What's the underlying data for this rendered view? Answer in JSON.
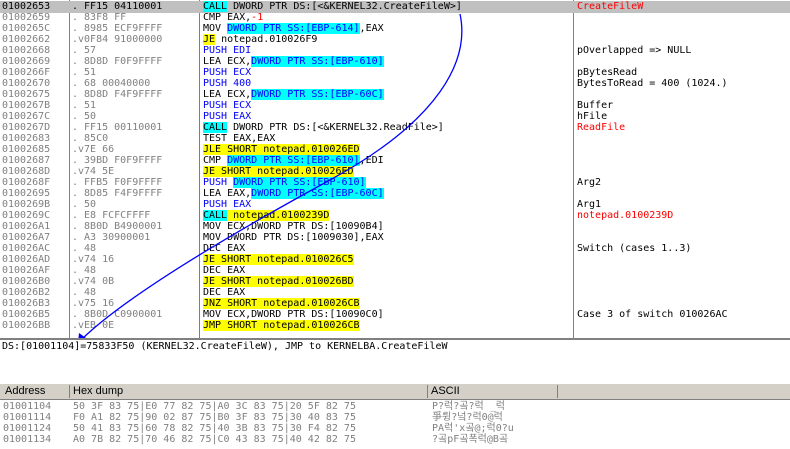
{
  "disasm": {
    "rows": [
      {
        "addr": "01002653",
        "hex": ". FF15 04110001",
        "asm": [
          {
            "t": "CALL",
            "c": "call"
          },
          {
            "t": " DWORD PTR DS:[<&KERNEL32.CreateFileW>]",
            "c": "plain"
          }
        ],
        "cmt": [
          {
            "t": "CreateFileW",
            "c": "red"
          }
        ],
        "sel": true
      },
      {
        "addr": "01002659",
        "hex": ". 83F8 FF",
        "asm": [
          {
            "t": "CMP EAX,",
            "c": "plain"
          },
          {
            "t": "-1",
            "c": "red"
          }
        ],
        "cmt": []
      },
      {
        "addr": "0100265C",
        "hex": ". 8985 ECF9FFFF",
        "asm": [
          {
            "t": "MOV ",
            "c": "plain"
          },
          {
            "t": "DWORD PTR SS:[EBP-614]",
            "c": "mem"
          },
          {
            "t": ",EAX",
            "c": "plain"
          }
        ],
        "cmt": []
      },
      {
        "addr": "01002662",
        "hex": ".v0F84 91000000",
        "asm": [
          {
            "t": "JE",
            "c": "jmp"
          },
          {
            "t": " notepad.010026F9",
            "c": "plain"
          }
        ],
        "cmt": []
      },
      {
        "addr": "01002668",
        "hex": ". 57",
        "asm": [
          {
            "t": "PUSH EDI",
            "c": "push"
          }
        ],
        "cmt": [
          {
            "t": "pOverlapped => NULL",
            "c": "plain"
          }
        ]
      },
      {
        "addr": "01002669",
        "hex": ". 8D8D F0F9FFFF",
        "asm": [
          {
            "t": "LEA ECX,",
            "c": "plain"
          },
          {
            "t": "DWORD PTR SS:[EBP-610]",
            "c": "mem"
          }
        ],
        "cmt": []
      },
      {
        "addr": "0100266F",
        "hex": ". 51",
        "asm": [
          {
            "t": "PUSH ECX",
            "c": "push"
          }
        ],
        "cmt": [
          {
            "t": "pBytesRead",
            "c": "plain"
          }
        ]
      },
      {
        "addr": "01002670",
        "hex": ". 68 00040000",
        "asm": [
          {
            "t": "PUSH 400",
            "c": "push"
          }
        ],
        "cmt": [
          {
            "t": "BytesToRead = 400 (1024.)",
            "c": "plain"
          }
        ]
      },
      {
        "addr": "01002675",
        "hex": ". 8D8D F4F9FFFF",
        "asm": [
          {
            "t": "LEA ECX,",
            "c": "plain"
          },
          {
            "t": "DWORD PTR SS:[EBP-60C]",
            "c": "mem"
          }
        ],
        "cmt": []
      },
      {
        "addr": "0100267B",
        "hex": ". 51",
        "asm": [
          {
            "t": "PUSH ECX",
            "c": "push"
          }
        ],
        "cmt": [
          {
            "t": "Buffer",
            "c": "plain"
          }
        ]
      },
      {
        "addr": "0100267C",
        "hex": ". 50",
        "asm": [
          {
            "t": "PUSH EAX",
            "c": "push"
          }
        ],
        "cmt": [
          {
            "t": "hFile",
            "c": "plain"
          }
        ]
      },
      {
        "addr": "0100267D",
        "hex": ". FF15 00110001",
        "asm": [
          {
            "t": "CALL",
            "c": "call"
          },
          {
            "t": " DWORD PTR DS:[<&KERNEL32.ReadFile>]",
            "c": "plain"
          }
        ],
        "cmt": [
          {
            "t": "ReadFile",
            "c": "red"
          }
        ]
      },
      {
        "addr": "01002683",
        "hex": ". 85C0",
        "asm": [
          {
            "t": "TEST EAX,EAX",
            "c": "plain"
          }
        ],
        "cmt": []
      },
      {
        "addr": "01002685",
        "hex": ".v7E 66",
        "asm": [
          {
            "t": "JLE SHORT notepad.010026ED",
            "c": "jmp"
          }
        ],
        "cmt": []
      },
      {
        "addr": "01002687",
        "hex": ". 39BD F0F9FFFF",
        "asm": [
          {
            "t": "CMP ",
            "c": "plain"
          },
          {
            "t": "DWORD PTR SS:[EBP-610]",
            "c": "mem"
          },
          {
            "t": ",EDI",
            "c": "plain"
          }
        ],
        "cmt": []
      },
      {
        "addr": "0100268D",
        "hex": ".v74 5E",
        "asm": [
          {
            "t": "JE SHORT notepad.010026ED",
            "c": "jmp"
          }
        ],
        "cmt": []
      },
      {
        "addr": "0100268F",
        "hex": ". FFB5 F0F9FFFF",
        "asm": [
          {
            "t": "PUSH ",
            "c": "push"
          },
          {
            "t": "DWORD PTR SS:[EBP-610]",
            "c": "mem"
          }
        ],
        "cmt": [
          {
            "t": "Arg2",
            "c": "plain"
          }
        ]
      },
      {
        "addr": "01002695",
        "hex": ". 8D85 F4F9FFFF",
        "asm": [
          {
            "t": "LEA EAX,",
            "c": "plain"
          },
          {
            "t": "DWORD PTR SS:[EBP-60C]",
            "c": "mem"
          }
        ],
        "cmt": []
      },
      {
        "addr": "0100269B",
        "hex": ". 50",
        "asm": [
          {
            "t": "PUSH EAX",
            "c": "push"
          }
        ],
        "cmt": [
          {
            "t": "Arg1",
            "c": "plain"
          }
        ]
      },
      {
        "addr": "0100269C",
        "hex": ". E8 FCFCFFFF",
        "asm": [
          {
            "t": "CALL",
            "c": "call"
          },
          {
            "t": " notepad.0100239D",
            "c": "jmp"
          }
        ],
        "cmt": [
          {
            "t": "notepad.0100239D",
            "c": "red"
          }
        ]
      },
      {
        "addr": "010026A1",
        "hex": ". 8B0D B4900001",
        "asm": [
          {
            "t": "MOV ECX,DWORD PTR DS:[10090B4]",
            "c": "plain"
          }
        ],
        "cmt": []
      },
      {
        "addr": "010026A7",
        "hex": ". A3 30900001",
        "asm": [
          {
            "t": "MOV DWORD PTR DS:[1009030],EAX",
            "c": "plain"
          }
        ],
        "cmt": []
      },
      {
        "addr": "010026AC",
        "hex": ". 48",
        "asm": [
          {
            "t": "DEC EAX",
            "c": "plain"
          }
        ],
        "cmt": [
          {
            "t": "Switch (cases 1..3)",
            "c": "plain"
          }
        ]
      },
      {
        "addr": "010026AD",
        "hex": ".v74 16",
        "asm": [
          {
            "t": "JE SHORT notepad.010026C5",
            "c": "jmp"
          }
        ],
        "cmt": []
      },
      {
        "addr": "010026AF",
        "hex": ". 48",
        "asm": [
          {
            "t": "DEC EAX",
            "c": "plain"
          }
        ],
        "cmt": []
      },
      {
        "addr": "010026B0",
        "hex": ".v74 0B",
        "asm": [
          {
            "t": "JE SHORT notepad.010026BD",
            "c": "jmp"
          }
        ],
        "cmt": []
      },
      {
        "addr": "010026B2",
        "hex": ". 48",
        "asm": [
          {
            "t": "DEC EAX",
            "c": "plain"
          }
        ],
        "cmt": []
      },
      {
        "addr": "010026B3",
        "hex": ".v75 16",
        "asm": [
          {
            "t": "JNZ SHORT notepad.010026CB",
            "c": "jmp"
          }
        ],
        "cmt": []
      },
      {
        "addr": "010026B5",
        "hex": ". 8B0D C0900001",
        "asm": [
          {
            "t": "MOV ECX,DWORD PTR DS:[10090C0]",
            "c": "plain"
          }
        ],
        "cmt": [
          {
            "t": "Case 3 of switch 010026AC",
            "c": "plain"
          }
        ]
      },
      {
        "addr": "010026BB",
        "hex": ".vEB 0E",
        "asm": [
          {
            "t": "JMP SHORT notepad.010026CB",
            "c": "jmp"
          }
        ],
        "cmt": []
      }
    ]
  },
  "info": {
    "text": "DS:[01001104]=75833F50 (KERNEL32.CreateFileW), JMP to KERNELBA.CreateFileW"
  },
  "dump": {
    "headers": {
      "address": "Address",
      "hex": "Hex dump",
      "ascii": "ASCII"
    },
    "rows": [
      {
        "addr": "01001104",
        "hex": "50 3F 83 75|E0 77 82 75|A0 3C 83 75|20 5F 82 75",
        "ascii": "P?럭?곸?럭 _럭"
      },
      {
        "addr": "01001114",
        "hex": "F0 A1 82 75|90 02 87 75|B0 3F 83 75|30 40 83 75",
        "ascii": "爭륑?넠?럭0@럭"
      },
      {
        "addr": "01001124",
        "hex": "50 41 83 75|60 78 82 75|40 3B 83 75|30 F4 82 75",
        "ascii": "PA럭'x곸@;럭0?u"
      },
      {
        "addr": "01001134",
        "hex": "A0 7B 82 75|70 46 82 75|C0 43 83 75|40 42 82 75",
        "ascii": "?곸pF곸폭럭@B곸"
      }
    ]
  },
  "colors": {
    "background": "#ffffff",
    "selection": "#c0c0c0",
    "jump_highlight": "#ffff00",
    "call_highlight": "#00ffff",
    "api_comment": "#ff0000",
    "arrow": "#0000ff"
  }
}
